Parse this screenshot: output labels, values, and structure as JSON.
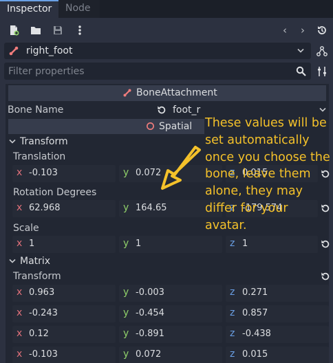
{
  "tabs": [
    {
      "label": "Inspector"
    },
    {
      "label": "Node"
    }
  ],
  "toolbar": {
    "new_icon": "new-resource-icon",
    "open_icon": "open-folder-icon",
    "save_icon": "save-icon",
    "menu_icon": "more-vertical-icon",
    "prev": "‹",
    "next": "›"
  },
  "object": {
    "name": "right_foot",
    "icon": "bone-icon"
  },
  "filter": {
    "placeholder": "Filter properties"
  },
  "node_type": {
    "label": "BoneAttachment"
  },
  "bone_name": {
    "label": "Bone Name",
    "value": "foot_r"
  },
  "spatial": {
    "label": "Spatial"
  },
  "transform_section": {
    "label": "Transform"
  },
  "translation": {
    "label": "Translation",
    "x": "-0.103",
    "y": "0.072",
    "z": "0.015"
  },
  "rotation": {
    "label": "Rotation Degrees",
    "x": "62.968",
    "y": "164.65",
    "z": "-179.574"
  },
  "scale": {
    "label": "Scale",
    "x": "1",
    "y": "1",
    "z": "1"
  },
  "matrix_section": {
    "label": "Matrix"
  },
  "matrix_transform": {
    "label": "Transform",
    "rows": [
      {
        "x": "0.963",
        "y": "-0.003",
        "z": "0.271"
      },
      {
        "x": "-0.243",
        "y": "-0.454",
        "z": "0.857"
      },
      {
        "x": "0.12",
        "y": "-0.891",
        "z": "-0.438"
      },
      {
        "x": "-0.103",
        "y": "0.072",
        "z": "0.015"
      }
    ]
  },
  "axes": {
    "x": "x",
    "y": "y",
    "z": "z"
  },
  "annotation": {
    "text": "These values will be set automatically once you choose the bone, leave them alone, they may differ for your avatar."
  },
  "colors": {
    "accent": "#6aa0e6",
    "annotation": "#f4c12a",
    "bone": "#f07c7c"
  }
}
